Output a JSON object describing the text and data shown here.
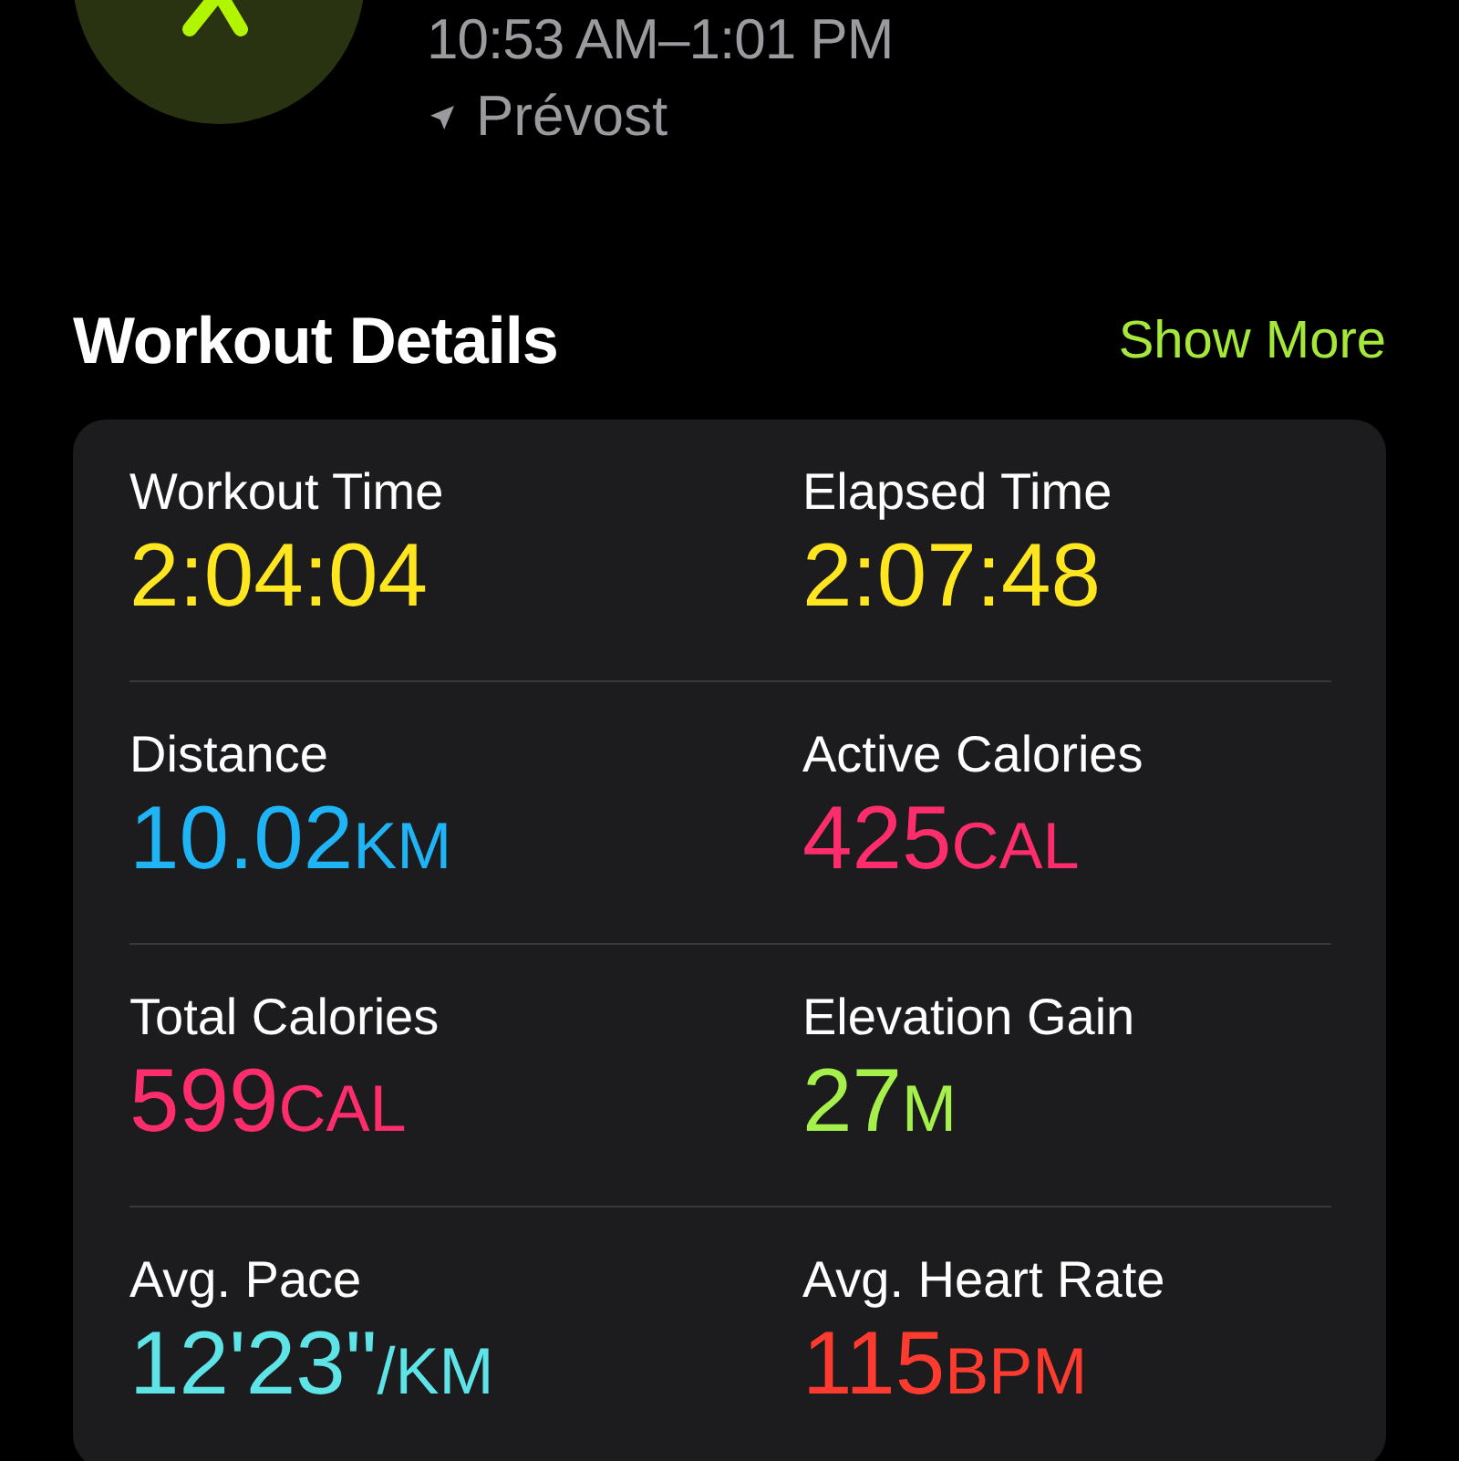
{
  "workout": {
    "time_range": "10:53 AM–1:01 PM",
    "location": "Prévost"
  },
  "details": {
    "title": "Workout Details",
    "show_more": "Show More",
    "metrics": [
      {
        "label": "Workout Time",
        "value": "2:04:04",
        "color": "#ffe61e"
      },
      {
        "label": "Elapsed Time",
        "value": "2:07:48",
        "color": "#ffe61e"
      },
      {
        "label": "Distance",
        "value": "10.02",
        "unit": "KM",
        "color": "#1eb4f5"
      },
      {
        "label": "Active Calories",
        "value": "425",
        "unit": "CAL",
        "color": "#ff2d6b"
      },
      {
        "label": "Total Calories",
        "value": "599",
        "unit": "CAL",
        "color": "#ff2d6b"
      },
      {
        "label": "Elevation Gain",
        "value": "27",
        "unit": "M",
        "color": "#a5f04a"
      },
      {
        "label": "Avg. Pace",
        "value": "12'23\"",
        "unit": "/KM",
        "color": "#5ee3e6"
      },
      {
        "label": "Avg. Heart Rate",
        "value": "115",
        "unit": "BPM",
        "color": "#ff3b30"
      }
    ]
  }
}
